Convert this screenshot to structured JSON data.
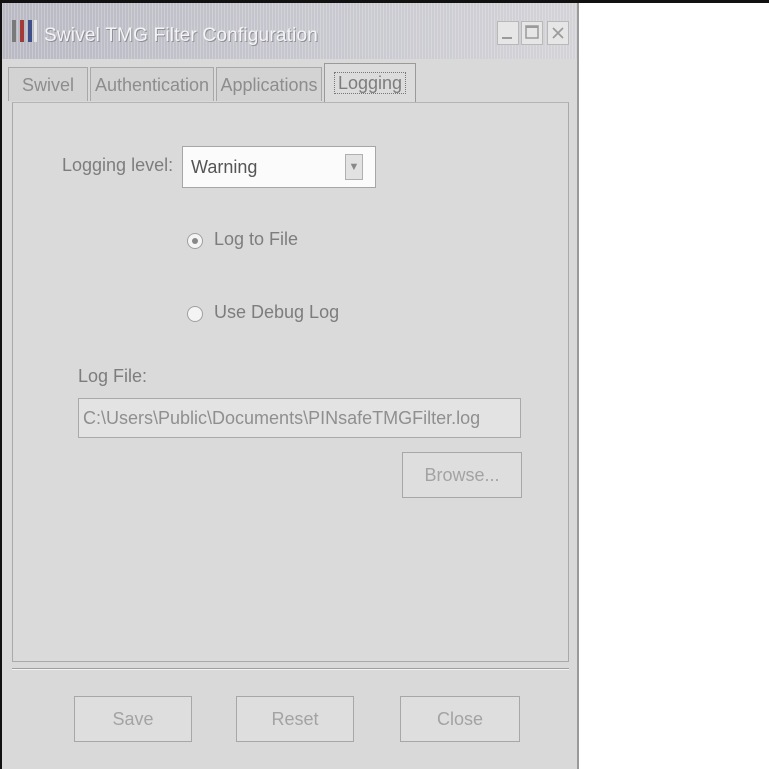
{
  "window": {
    "title": "Swivel TMG Filter Configuration"
  },
  "tabs": [
    {
      "label": "Swivel",
      "active": false
    },
    {
      "label": "Authentication",
      "active": false
    },
    {
      "label": "Applications",
      "active": false
    },
    {
      "label": "Logging",
      "active": true
    }
  ],
  "logging": {
    "level_label": "Logging level:",
    "level_value": "Warning",
    "options": [
      {
        "label": "Log to File",
        "checked": true
      },
      {
        "label": "Use Debug Log",
        "checked": false
      }
    ],
    "log_file_label": "Log File:",
    "log_file_path": "C:\\Users\\Public\\Documents\\PINsafeTMGFilter.log",
    "browse_label": "Browse..."
  },
  "footer": {
    "save_label": "Save",
    "reset_label": "Reset",
    "close_label": "Close"
  },
  "icons": {
    "app": "swivel-logo-icon",
    "minimize": "minimize-icon",
    "maximize": "maximize-icon",
    "close": "close-icon",
    "dropdown": "chevron-down-icon"
  }
}
